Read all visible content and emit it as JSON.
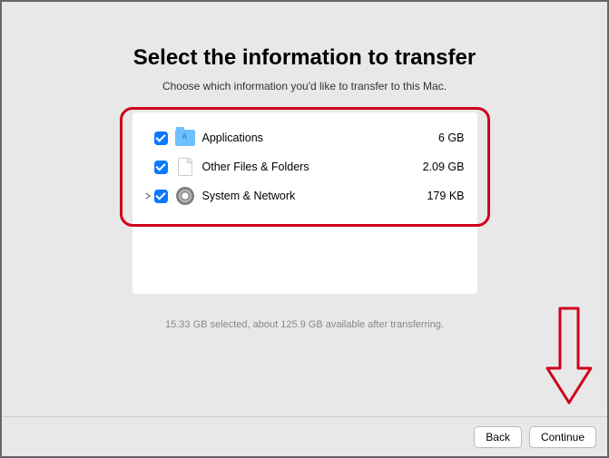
{
  "title": "Select the information to transfer",
  "subtitle": "Choose which information you'd like to transfer to this Mac.",
  "items": [
    {
      "label": "Applications",
      "size": "6 GB",
      "expandable": false,
      "icon": "folder"
    },
    {
      "label": "Other Files & Folders",
      "size": "2.09 GB",
      "expandable": false,
      "icon": "file"
    },
    {
      "label": "System & Network",
      "size": "179 KB",
      "expandable": true,
      "icon": "gear"
    }
  ],
  "status": "15.33 GB selected, about 125.9 GB available after transferring.",
  "buttons": {
    "back": "Back",
    "continue": "Continue"
  },
  "colors": {
    "accent": "#0a7aff",
    "highlight": "#d0021b"
  }
}
